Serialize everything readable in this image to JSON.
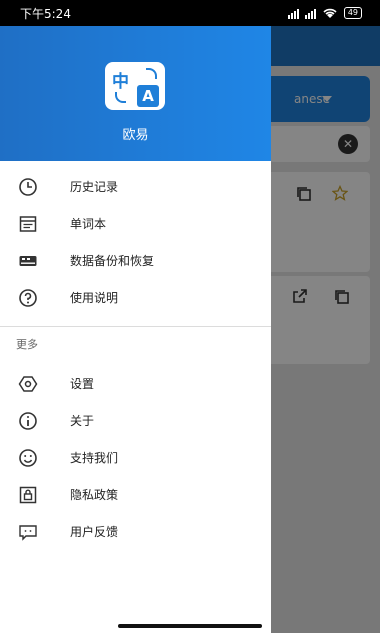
{
  "status_bar": {
    "time": "下午5:24",
    "battery": "49"
  },
  "app": {
    "name": "欧易"
  },
  "logo": {
    "zh_char": "中",
    "en_char": "A"
  },
  "menu_primary": [
    {
      "label": "历史记录",
      "icon": "history-icon"
    },
    {
      "label": "单词本",
      "icon": "wordbook-icon"
    },
    {
      "label": "数据备份和恢复",
      "icon": "backup-icon"
    },
    {
      "label": "使用说明",
      "icon": "help-icon"
    }
  ],
  "section_more": "更多",
  "menu_more": [
    {
      "label": "设置",
      "icon": "settings-icon"
    },
    {
      "label": "关于",
      "icon": "info-icon"
    },
    {
      "label": "支持我们",
      "icon": "smile-icon"
    },
    {
      "label": "隐私政策",
      "icon": "privacy-icon"
    },
    {
      "label": "用户反馈",
      "icon": "feedback-icon"
    }
  ],
  "background": {
    "language_label": "anese"
  },
  "colors": {
    "header_start": "#1f6fc5",
    "header_end": "#1f86e6",
    "accent": "#1f7fd8"
  }
}
